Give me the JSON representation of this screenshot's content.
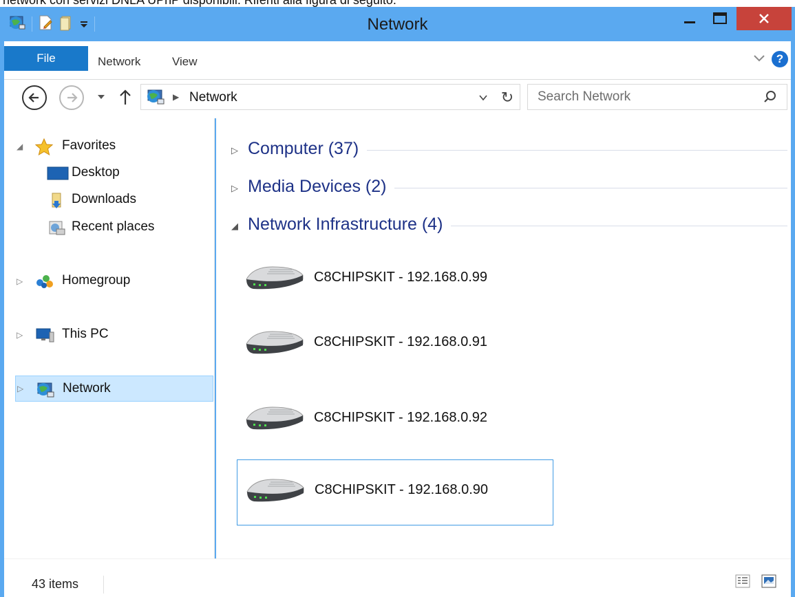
{
  "top_text": "network con servizi DNLA UPnP disponibili. Riferiti alla figura di seguito.",
  "window": {
    "title": "Network"
  },
  "ribbon": {
    "file_label": "File",
    "tabs": [
      "Network",
      "View"
    ],
    "help_label": "?"
  },
  "address": {
    "path": "Network",
    "search_placeholder": "Search Network"
  },
  "sidebar": {
    "favorites": {
      "label": "Favorites",
      "items": [
        "Desktop",
        "Downloads",
        "Recent places"
      ]
    },
    "homegroup": "Homegroup",
    "this_pc": "This PC",
    "network": "Network"
  },
  "content": {
    "groups": [
      {
        "title": "Computer (37)",
        "expanded": false
      },
      {
        "title": "Media Devices (2)",
        "expanded": false
      },
      {
        "title": "Network Infrastructure (4)",
        "expanded": true
      }
    ],
    "devices": [
      "C8CHIPSKIT - 192.168.0.99",
      "C8CHIPSKIT - 192.168.0.91",
      "C8CHIPSKIT - 192.168.0.92",
      "C8CHIPSKIT - 192.168.0.90"
    ],
    "selected_device_index": 3
  },
  "status": {
    "item_count": "43 items"
  },
  "colors": {
    "title_bar": "#5aa9f0",
    "file_tab": "#1979ca",
    "close_button": "#c7433b",
    "group_header": "#1e3287",
    "selection_bg": "#cce8ff",
    "selection_border": "#3f9ae4"
  },
  "icons": {
    "quick_access": [
      "network-globe-icon",
      "properties-icon",
      "new-folder-icon",
      "customize-dropdown-icon"
    ],
    "window_controls": [
      "minimize-icon",
      "maximize-icon",
      "close-icon"
    ],
    "nav": [
      "back-arrow-icon",
      "forward-arrow-icon",
      "recent-locations-icon",
      "up-arrow-icon",
      "refresh-icon",
      "search-icon"
    ],
    "sidebar": [
      "star-icon",
      "desktop-icon",
      "downloads-folder-icon",
      "recent-places-icon",
      "homegroup-icon",
      "computer-icon",
      "network-globe-icon"
    ],
    "device": "router-icon",
    "status": [
      "details-view-icon",
      "large-icons-view-icon"
    ]
  }
}
